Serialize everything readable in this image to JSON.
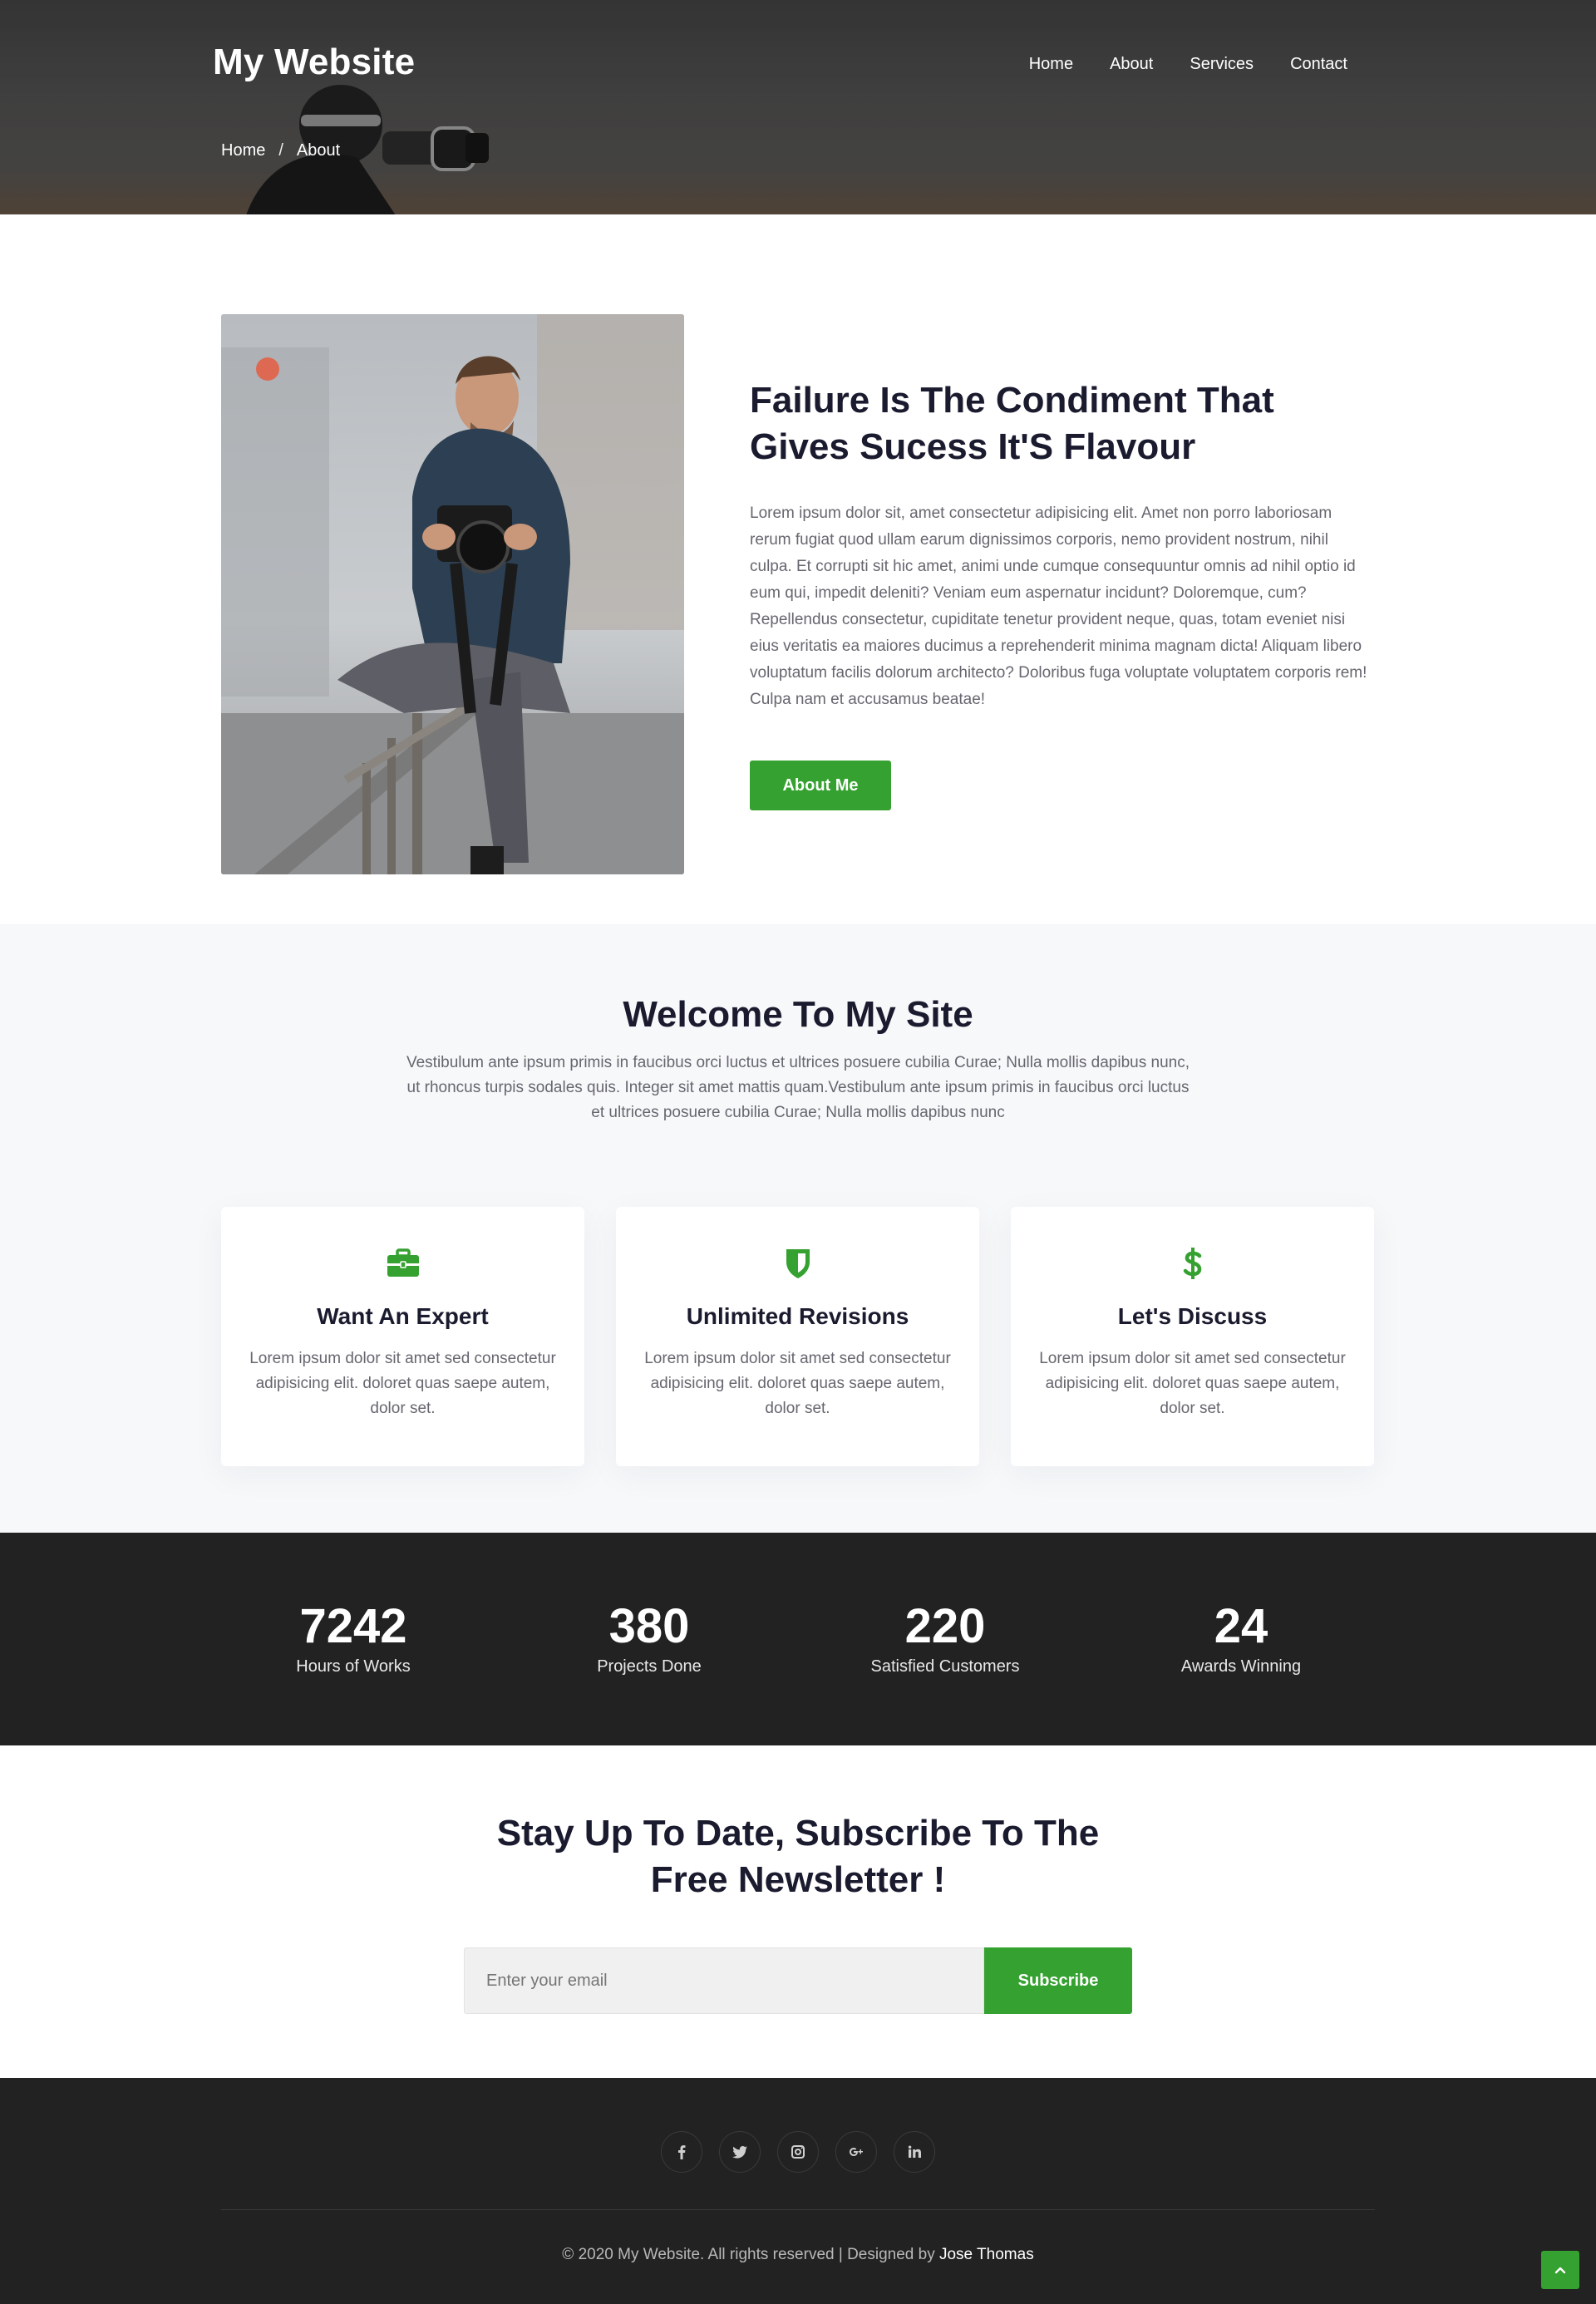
{
  "header": {
    "brand": "My Website",
    "nav": [
      "Home",
      "About",
      "Services",
      "Contact"
    ],
    "breadcrumb": [
      "Home",
      "About"
    ],
    "breadcrumb_separator": "/"
  },
  "about": {
    "title": "Failure Is The Condiment That Gives Sucess It'S Flavour",
    "body": "Lorem ipsum dolor sit, amet consectetur adipisicing elit. Amet non porro laboriosam rerum fugiat quod ullam earum dignissimos corporis, nemo provident nostrum, nihil culpa. Et corrupti sit hic amet, animi unde cumque consequuntur omnis ad nihil optio id eum qui, impedit deleniti? Veniam eum aspernatur incidunt? Doloremque, cum? Repellendus consectetur, cupiditate tenetur provident neque, quas, totam eveniet nisi eius veritatis ea maiores ducimus a reprehenderit minima magnam dicta! Aliquam libero voluptatum facilis dolorum architecto? Doloribus fuga voluptate voluptatem corporis rem! Culpa nam et accusamus beatae!",
    "button": "About Me"
  },
  "welcome": {
    "title": "Welcome To My Site",
    "subtitle": "Vestibulum ante ipsum primis in faucibus orci luctus et ultrices posuere cubilia Curae; Nulla mollis dapibus nunc, ut rhoncus turpis sodales quis. Integer sit amet mattis quam.Vestibulum ante ipsum primis in faucibus orci luctus et ultrices posuere cubilia Curae; Nulla mollis dapibus nunc",
    "cards": [
      {
        "icon": "briefcase-icon",
        "title": "Want An Expert",
        "text": "Lorem ipsum dolor sit amet sed consectetur adipisicing elit. doloret quas saepe autem, dolor set."
      },
      {
        "icon": "shield-icon",
        "title": "Unlimited Revisions",
        "text": "Lorem ipsum dolor sit amet sed consectetur adipisicing elit. doloret quas saepe autem, dolor set."
      },
      {
        "icon": "dollar-icon",
        "title": "Let's Discuss",
        "text": "Lorem ipsum dolor sit amet sed consectetur adipisicing elit. doloret quas saepe autem, dolor set."
      }
    ]
  },
  "stats": [
    {
      "value": "7242",
      "label": "Hours of Works"
    },
    {
      "value": "380",
      "label": "Projects Done"
    },
    {
      "value": "220",
      "label": "Satisfied Customers"
    },
    {
      "value": "24",
      "label": "Awards Winning"
    }
  ],
  "newsletter": {
    "title": "Stay Up To Date, Subscribe To The Free Newsletter !",
    "placeholder": "Enter your email",
    "button": "Subscribe"
  },
  "footer": {
    "social": [
      "facebook-icon",
      "twitter-icon",
      "instagram-icon",
      "google-plus-icon",
      "linkedin-icon"
    ],
    "copyright": "© 2020 My Website. All rights reserved | Designed by ",
    "designer": "Jose Thomas"
  },
  "colors": {
    "accent": "#35a130",
    "dark": "#222222",
    "heading": "#1b1b2f",
    "body_text": "#66666f"
  }
}
